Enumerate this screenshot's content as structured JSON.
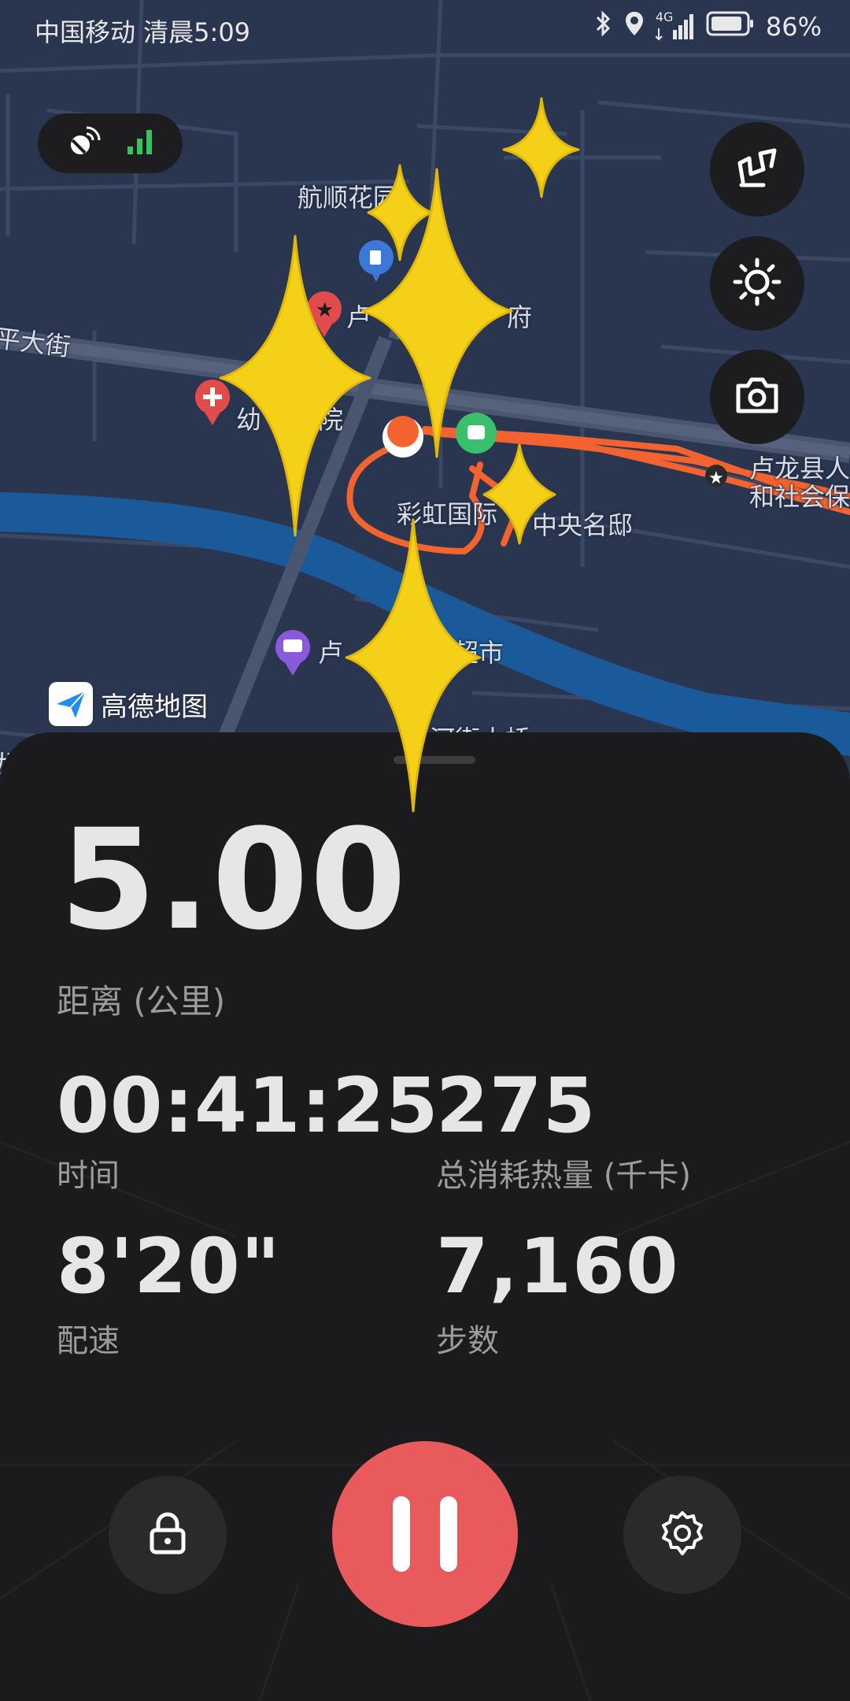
{
  "status_bar": {
    "carrier_time": "中国移动 清晨5:09",
    "network": "4G",
    "battery": "86%",
    "icons": [
      "bluetooth-icon",
      "location-icon",
      "signal-icon",
      "battery-icon"
    ]
  },
  "map": {
    "provider_logo": "高德地图",
    "labels": {
      "hangshun": "航顺花园",
      "street_left": "平大街",
      "caihong": "彩虹国际",
      "zhongyang": "中央名邸",
      "market_partial": "卢",
      "market_suffix": "超市",
      "kindergarten_partial": "幼",
      "kindergarten_suffix": "院",
      "mansion_partial": "卢",
      "mansion_suffix": "府",
      "county_hospital": "卢龙县人",
      "county_hospital_line2": "和社会保",
      "bottom_street": "河街大桥",
      "left_edge": "龙县"
    },
    "gps_status": "GPS signal strong",
    "buttons": [
      "route-icon",
      "brightness-icon",
      "camera-icon"
    ]
  },
  "workout": {
    "distance_value": "5.00",
    "distance_label": "距离 (公里)",
    "time_value": "00:41:25",
    "time_label": "时间",
    "calories_value": "275",
    "calories_label": "总消耗热量 (千卡)",
    "pace_value": "8'20\"",
    "pace_label": "配速",
    "steps_value": "7,160",
    "steps_label": "步数"
  },
  "controls": {
    "lock": "lock-icon",
    "pause": "pause-icon",
    "settings": "settings-gear-icon"
  },
  "colors": {
    "accent_red": "#e85a5c",
    "route_orange": "#f2632f",
    "river_blue": "#1a5a9a",
    "panel_bg": "#1b1b1d",
    "map_bg": "#2a3650",
    "sticker_yellow": "#f5d018"
  }
}
